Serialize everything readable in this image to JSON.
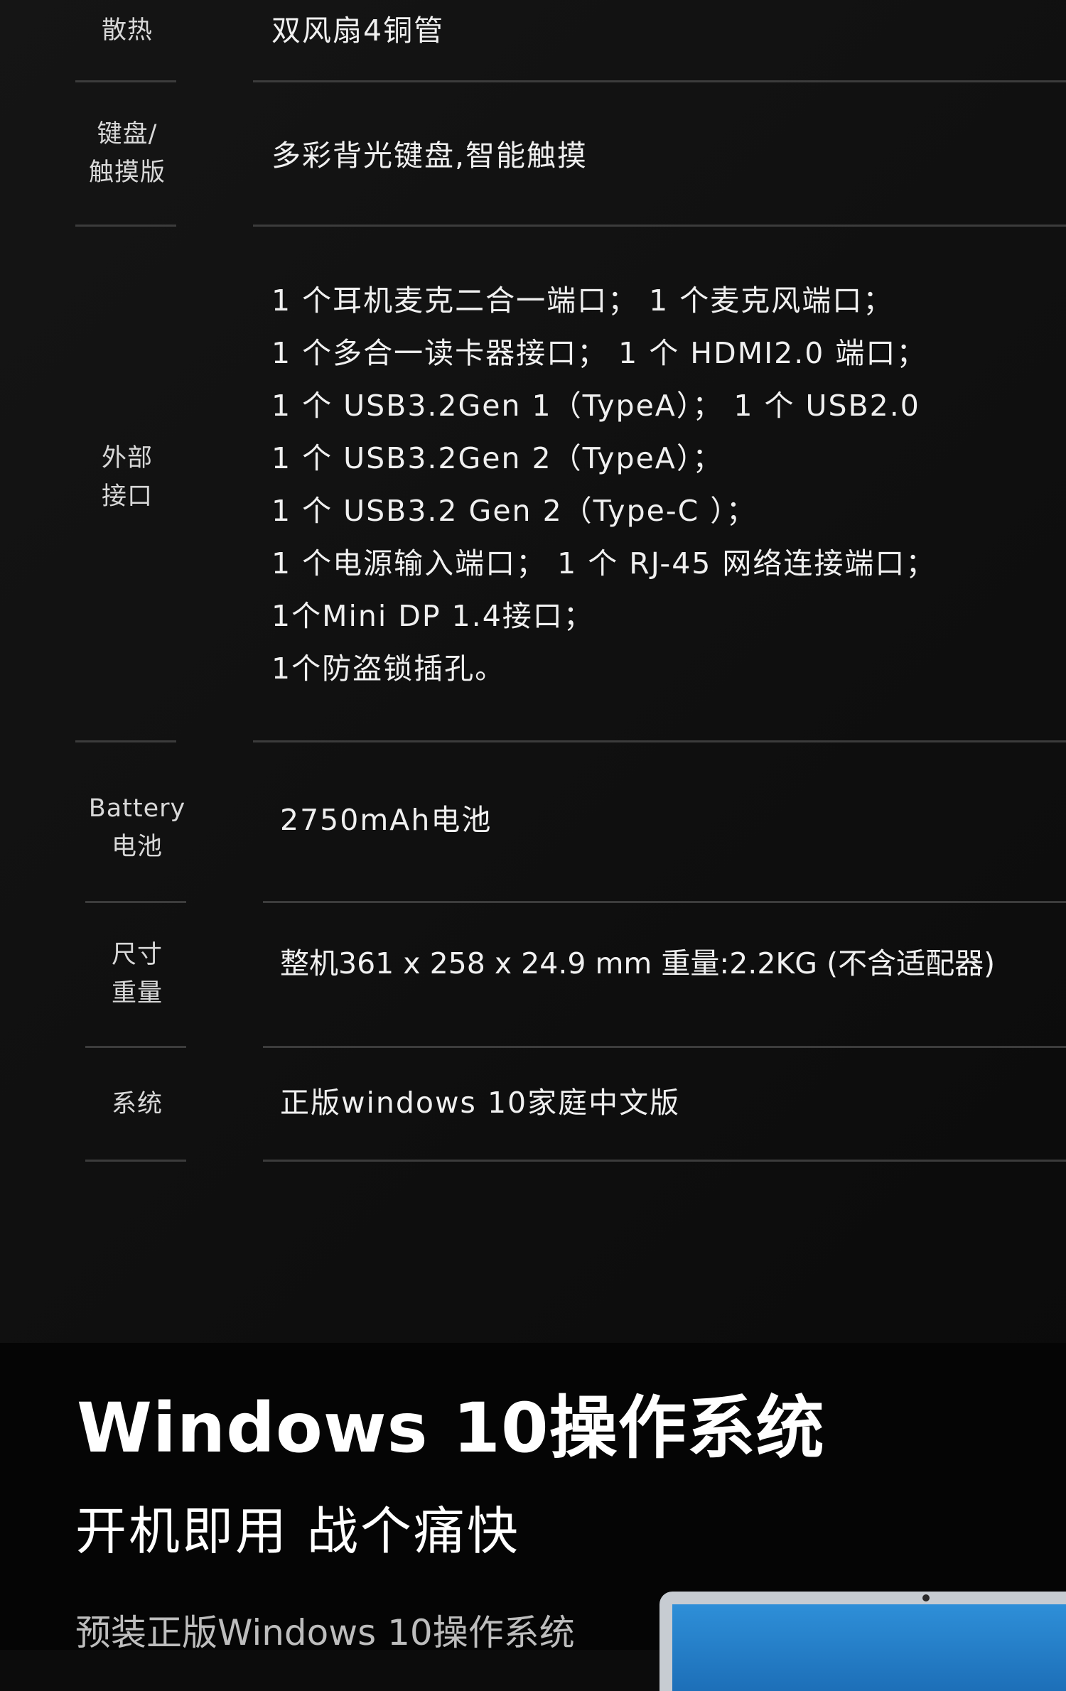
{
  "specs": {
    "cooling": {
      "label": "散热",
      "value": "双风扇4铜管"
    },
    "keyboard": {
      "label": "键盘/\n触摸版",
      "value": "多彩背光键盘,智能触摸"
    },
    "ports": {
      "label": "外部\n接口",
      "lines": [
        "1 个耳机麦克二合一端口； 1 个麦克风端口；",
        "1 个多合一读卡器接口； 1 个 HDMI2.0 端口；",
        "1 个 USB3.2Gen 1（TypeA）； 1 个 USB2.0",
        "1 个 USB3.2Gen 2（TypeA）；",
        "1 个 USB3.2 Gen 2（Type-C ）；",
        "1 个电源输入端口； 1 个 RJ-45 网络连接端口；",
        "1个Mini DP 1.4接口；",
        "1个防盗锁插孔。"
      ]
    },
    "battery": {
      "label": "Battery\n电池",
      "value": "2750mAh电池"
    },
    "size": {
      "label": "尺寸\n重量",
      "value": "整机361 x 258 x 24.9 mm 重量:2.2KG (不含适配器)"
    },
    "os": {
      "label": "系统",
      "value": "正版windows 10家庭中文版"
    }
  },
  "intro": {
    "title": "Windows 10操作系统",
    "subtitle": "开机即用 战个痛快",
    "description": "预装正版Windows 10操作系统"
  }
}
